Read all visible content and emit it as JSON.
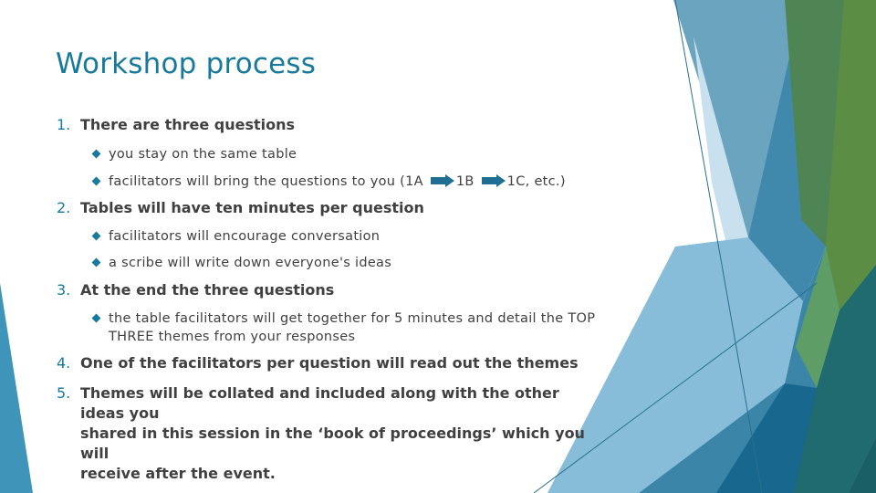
{
  "slide": {
    "title": "Workshop process",
    "items": [
      {
        "number": "1.",
        "text": "There are three questions",
        "subitems": [
          {
            "text": "you stay on the same table"
          },
          {
            "text_parts": [
              "facilitators will bring the questions to you (1A",
              "1B",
              "1C, etc.)"
            ],
            "arrow_icon": "right-arrow"
          }
        ]
      },
      {
        "number": "2.",
        "text": "Tables will have ten minutes per question",
        "subitems": [
          {
            "text": "facilitators will encourage conversation"
          },
          {
            "text": "a scribe will write down everyone's ideas"
          }
        ]
      },
      {
        "number": "3.",
        "text": "At the end the three questions",
        "subitems": [
          {
            "line1": "the table facilitators will get together for 5 minutes and detail the TOP",
            "line2": "THREE themes from your responses"
          }
        ]
      },
      {
        "number": "4.",
        "text": "One of the facilitators per question will read out the themes"
      },
      {
        "number": "5.",
        "line1": "Themes will be collated and included along with the other ideas you",
        "line2": "shared in this session in the ‘book of proceedings’ which you will",
        "line3": "receive after the event."
      }
    ]
  },
  "theme": {
    "accent": "#17799c",
    "text": "#404040",
    "bullet": "#17799c",
    "arrow": "#1f6f94"
  }
}
